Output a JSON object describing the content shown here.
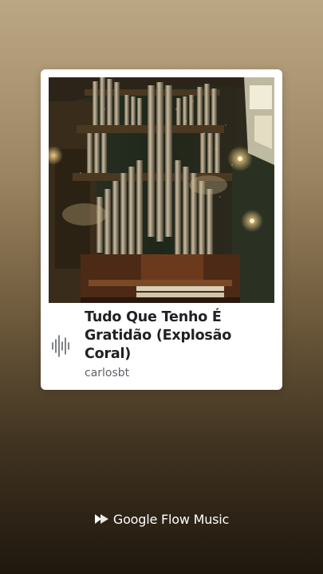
{
  "track": {
    "title": "Tudo Que Tenho É Gratidão (Explosão Coral)",
    "artist": "carlosbt"
  },
  "branding": {
    "name": "Google Flow Music"
  },
  "icons": {
    "track_icon": "audio-waveform-icon",
    "brand_icon": "google-flow-music-logo-icon"
  },
  "colors": {
    "background_top": "#bca785",
    "background_bottom": "#20180e",
    "card": "#ffffff",
    "title_text": "#202124",
    "artist_text": "#5f6368"
  }
}
